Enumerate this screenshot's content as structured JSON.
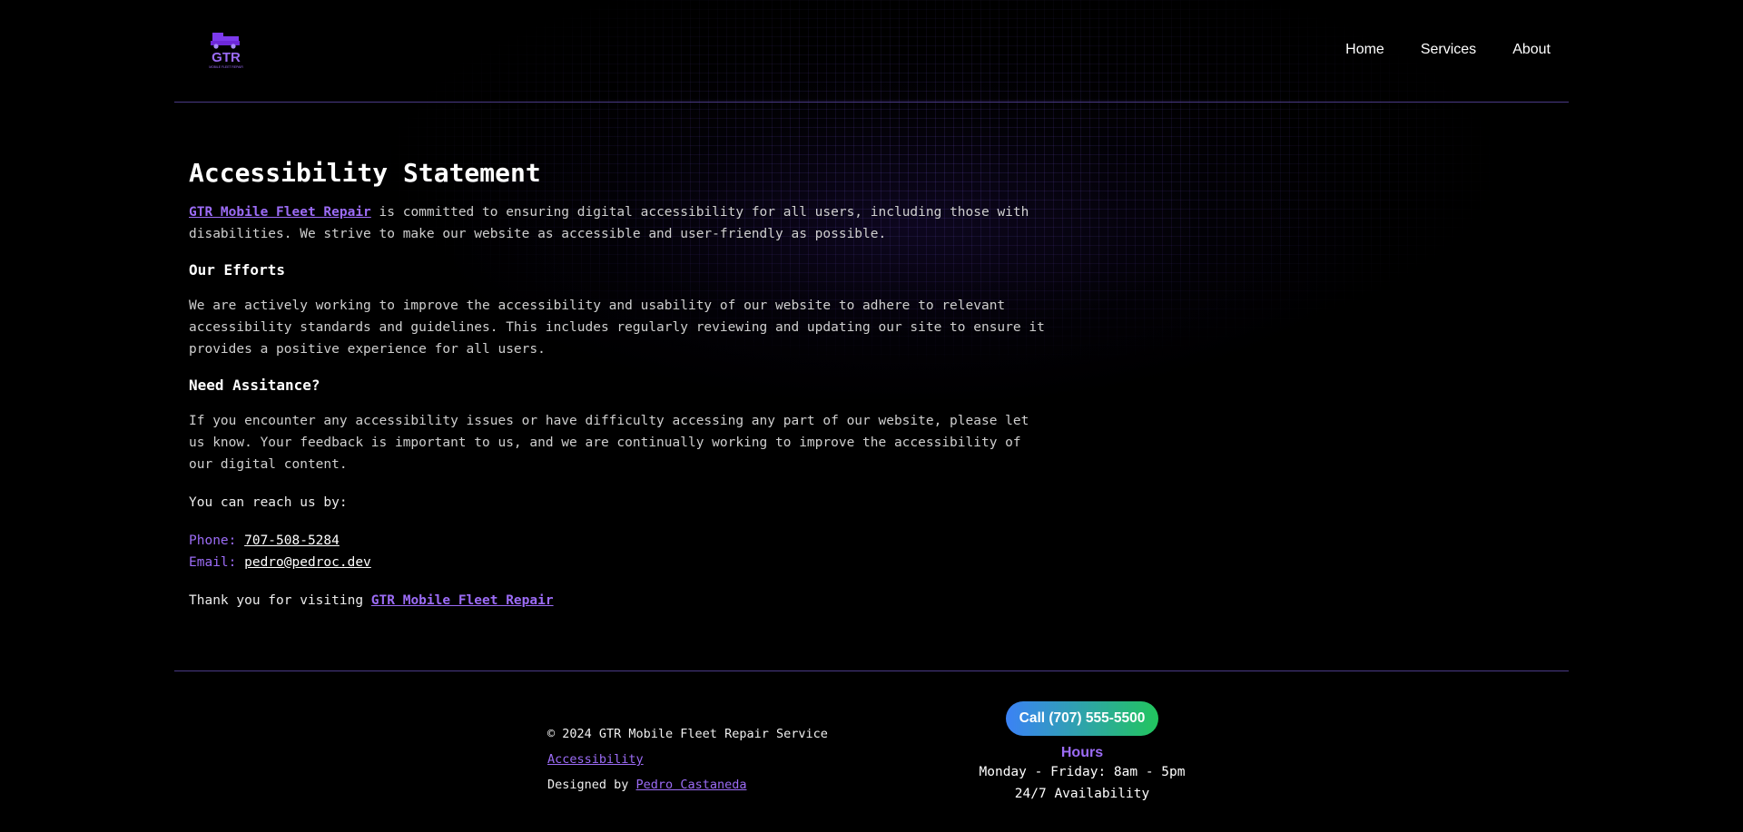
{
  "colors": {
    "background": "#000000",
    "accent_purple": "#9c6cf6",
    "divider": "#4a3a86",
    "call_gradient_start": "#3b82f6",
    "call_gradient_end": "#22c55e"
  },
  "header": {
    "logo": {
      "icon": "gtr-truck-logo-icon",
      "text": "GTR",
      "tagline": "MOBILE FLEET REPAIR"
    },
    "nav": [
      {
        "label": "Home"
      },
      {
        "label": "Services"
      },
      {
        "label": "About"
      }
    ]
  },
  "main": {
    "title": "Accessibility Statement",
    "intro": {
      "brand": "GTR Mobile Fleet Repair",
      "text": " is committed to ensuring digital accessibility for all users, including those with disabilities. We strive to make our website as accessible and user-friendly as possible."
    },
    "efforts": {
      "heading": "Our Efforts",
      "text": "We are actively working to improve the accessibility and usability of our website to adhere to relevant accessibility standards and guidelines. This includes regularly reviewing and updating our site to ensure it provides a positive experience for all users."
    },
    "assistance": {
      "heading": "Need Assitance?",
      "text": "If you encounter any accessibility issues or have difficulty accessing any part of our website, please let us know. Your feedback is important to us, and we are continually working to improve the accessibility of our digital content."
    },
    "reach_text": "You can reach us by:",
    "contact": {
      "phone_label": "Phone: ",
      "phone_value": "707-508-5284",
      "email_label": "Email: ",
      "email_value": "pedro@pedroc.dev"
    },
    "thanks": {
      "text": "Thank you for visiting ",
      "brand": "GTR Mobile Fleet Repair"
    }
  },
  "footer": {
    "copyright": "© 2024 GTR Mobile Fleet Repair Service",
    "accessibility_link": "Accessibility",
    "designed_by_text": "Designed by ",
    "designer_link": "Pedro Castaneda",
    "call_button": "Call (707) 555-5500",
    "hours_title": "Hours",
    "hours_weekday": "Monday - Friday: 8am - 5pm",
    "hours_availability": "24/7 Availability"
  }
}
